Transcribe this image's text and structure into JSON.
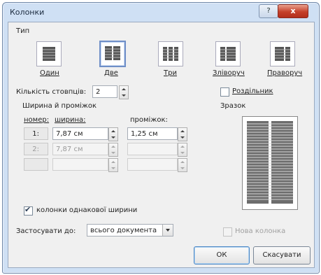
{
  "window": {
    "title": "Колонки",
    "help_label": "?",
    "close_label": "x"
  },
  "presets": {
    "group_label": "Тип",
    "items": [
      {
        "label": "Один",
        "icon": "one-column-icon",
        "cols": 1
      },
      {
        "label": "Две",
        "icon": "two-columns-icon",
        "cols": 2
      },
      {
        "label": "Три",
        "icon": "three-columns-icon",
        "cols": 3
      },
      {
        "label": "Зліворуч",
        "icon": "left-column-icon",
        "cols": 2
      },
      {
        "label": "Праворуч",
        "icon": "right-column-icon",
        "cols": 2
      }
    ],
    "selected": "Две"
  },
  "columns_count": {
    "label": "Кількість стовпців:",
    "value": "2"
  },
  "separator": {
    "label": "Роздільник",
    "checked": false
  },
  "width_spacing": {
    "group_label": "Ширина й проміжок",
    "headers": {
      "number": "номер:",
      "width": "ширина:",
      "spacing": "проміжок:"
    },
    "rows": [
      {
        "number": "1:",
        "width": "7,87 см",
        "spacing": "1,25 см",
        "enabled": true
      },
      {
        "number": "2:",
        "width": "7,87 см",
        "spacing": "",
        "enabled": false
      },
      {
        "number": "",
        "width": "",
        "spacing": "",
        "enabled": false
      }
    ]
  },
  "sample": {
    "label": "Зразок"
  },
  "equal_width": {
    "label": "колонки однакової ширини",
    "checked": true
  },
  "apply_to": {
    "label": "Застосувати до:",
    "value": "всього документа"
  },
  "new_column": {
    "label": "Нова колонка",
    "checked": false
  },
  "buttons": {
    "ok": "ОК",
    "cancel": "Скасувати"
  }
}
